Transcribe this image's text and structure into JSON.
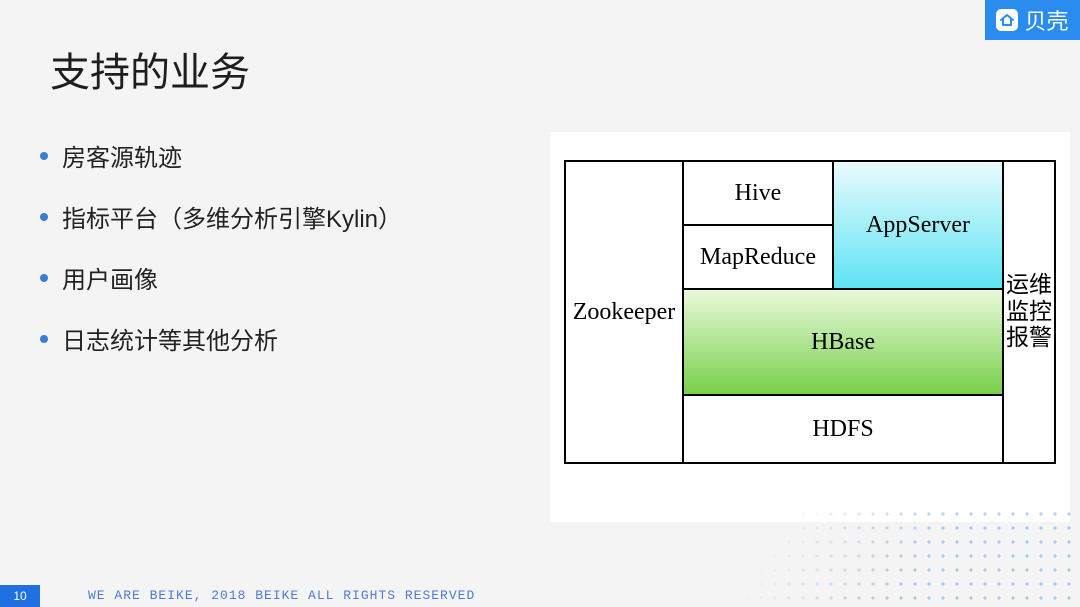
{
  "brand": {
    "name": "贝壳"
  },
  "slide": {
    "title": "支持的业务",
    "bullets": [
      "房客源轨迹",
      "指标平台（多维分析引擎Kylin）",
      "用户画像",
      "日志统计等其他分析"
    ]
  },
  "diagram": {
    "zookeeper": "Zookeeper",
    "hive": "Hive",
    "mapreduce": "MapReduce",
    "appserver": "AppServer",
    "hbase": "HBase",
    "hdfs": "HDFS",
    "ops": "运维\n监控\n报警"
  },
  "footer": {
    "page": "10",
    "copyright": "WE ARE BEIKE, 2018 BEIKE ALL RIGHTS RESERVED"
  }
}
